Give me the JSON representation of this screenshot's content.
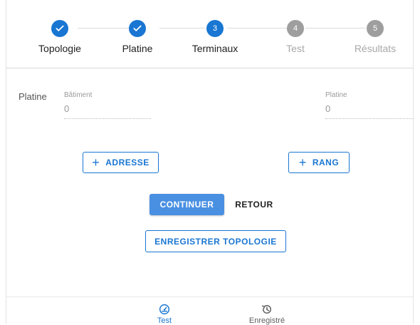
{
  "stepper": {
    "steps": [
      {
        "label": "Topologie",
        "state": "done",
        "number": ""
      },
      {
        "label": "Platine",
        "state": "done",
        "number": ""
      },
      {
        "label": "Terminaux",
        "state": "active",
        "number": "3"
      },
      {
        "label": "Test",
        "state": "pending",
        "number": "4"
      },
      {
        "label": "Résultats",
        "state": "pending",
        "number": "5"
      }
    ],
    "colors": {
      "active": "#1976d2",
      "pending": "#9e9e9e"
    }
  },
  "form": {
    "row_label": "Platine",
    "fields": [
      {
        "label": "Bâtiment",
        "value": "0"
      },
      {
        "label": "Platine",
        "value": "0"
      }
    ]
  },
  "buttons": {
    "add_address": "ADRESSE",
    "add_row": "RANG",
    "continue": "CONTINUER",
    "back": "RETOUR",
    "save_topology": "ENREGISTRER TOPOLOGIE"
  },
  "bottom_nav": {
    "items": [
      {
        "label": "Test",
        "icon": "speedometer-icon",
        "active": true
      },
      {
        "label": "Enregistré",
        "icon": "history-icon",
        "active": false
      }
    ]
  },
  "colors": {
    "accent": "#1976d2",
    "primary_button": "#4a90e2"
  }
}
